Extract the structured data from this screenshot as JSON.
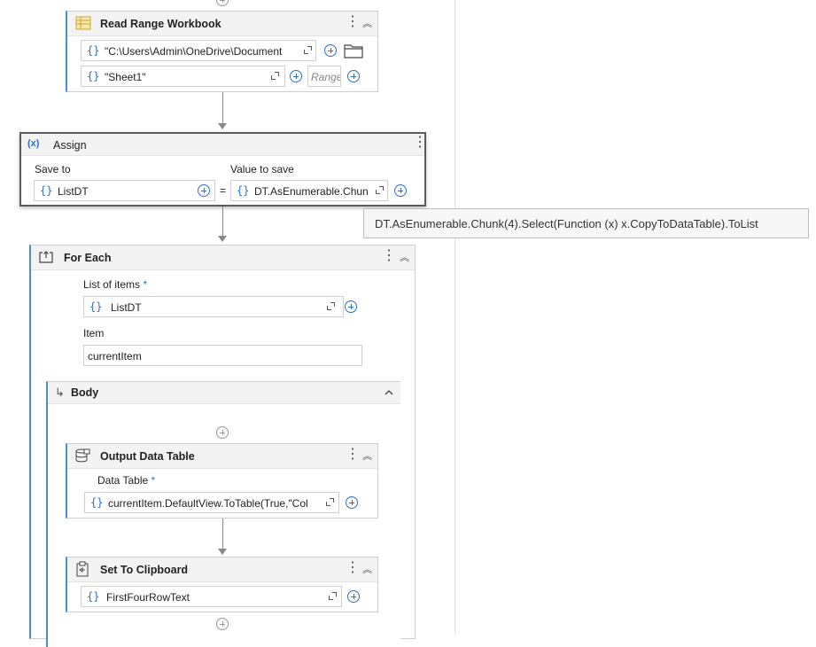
{
  "read_range": {
    "title": "Read Range Workbook",
    "path_value": "\"C:\\Users\\Admin\\OneDrive\\Document",
    "sheet_value": "\"Sheet1\"",
    "range_placeholder": "Range",
    "icon": "excel-icon"
  },
  "assign": {
    "title": "Assign",
    "icon_text": "(x)",
    "save_to_label": "Save to",
    "save_to_value": "ListDT",
    "equals": "=",
    "value_label": "Value to save",
    "value_value": "DT.AsEnumerable.Chun"
  },
  "tooltip": {
    "text": "DT.AsEnumerable.Chunk(4).Select(Function (x) x.CopyToDataTable).ToList"
  },
  "for_each": {
    "title": "For Each",
    "list_label": "List of items",
    "required_mark": "*",
    "list_value": "ListDT",
    "item_label": "Item",
    "item_value": "currentItem"
  },
  "body": {
    "title": "Body",
    "arrow": "↳"
  },
  "output_dt": {
    "title": "Output Data Table",
    "field_label": "Data Table",
    "required_mark": "*",
    "value": "currentItem.DefaultView.ToTable(True,\"Col"
  },
  "clipboard": {
    "title": "Set To Clipboard",
    "value": "FirstFourRowText"
  },
  "glyphs": {
    "brace": "{}",
    "kebab": "⋮",
    "collapse": "︽",
    "chevron_up": "^"
  }
}
